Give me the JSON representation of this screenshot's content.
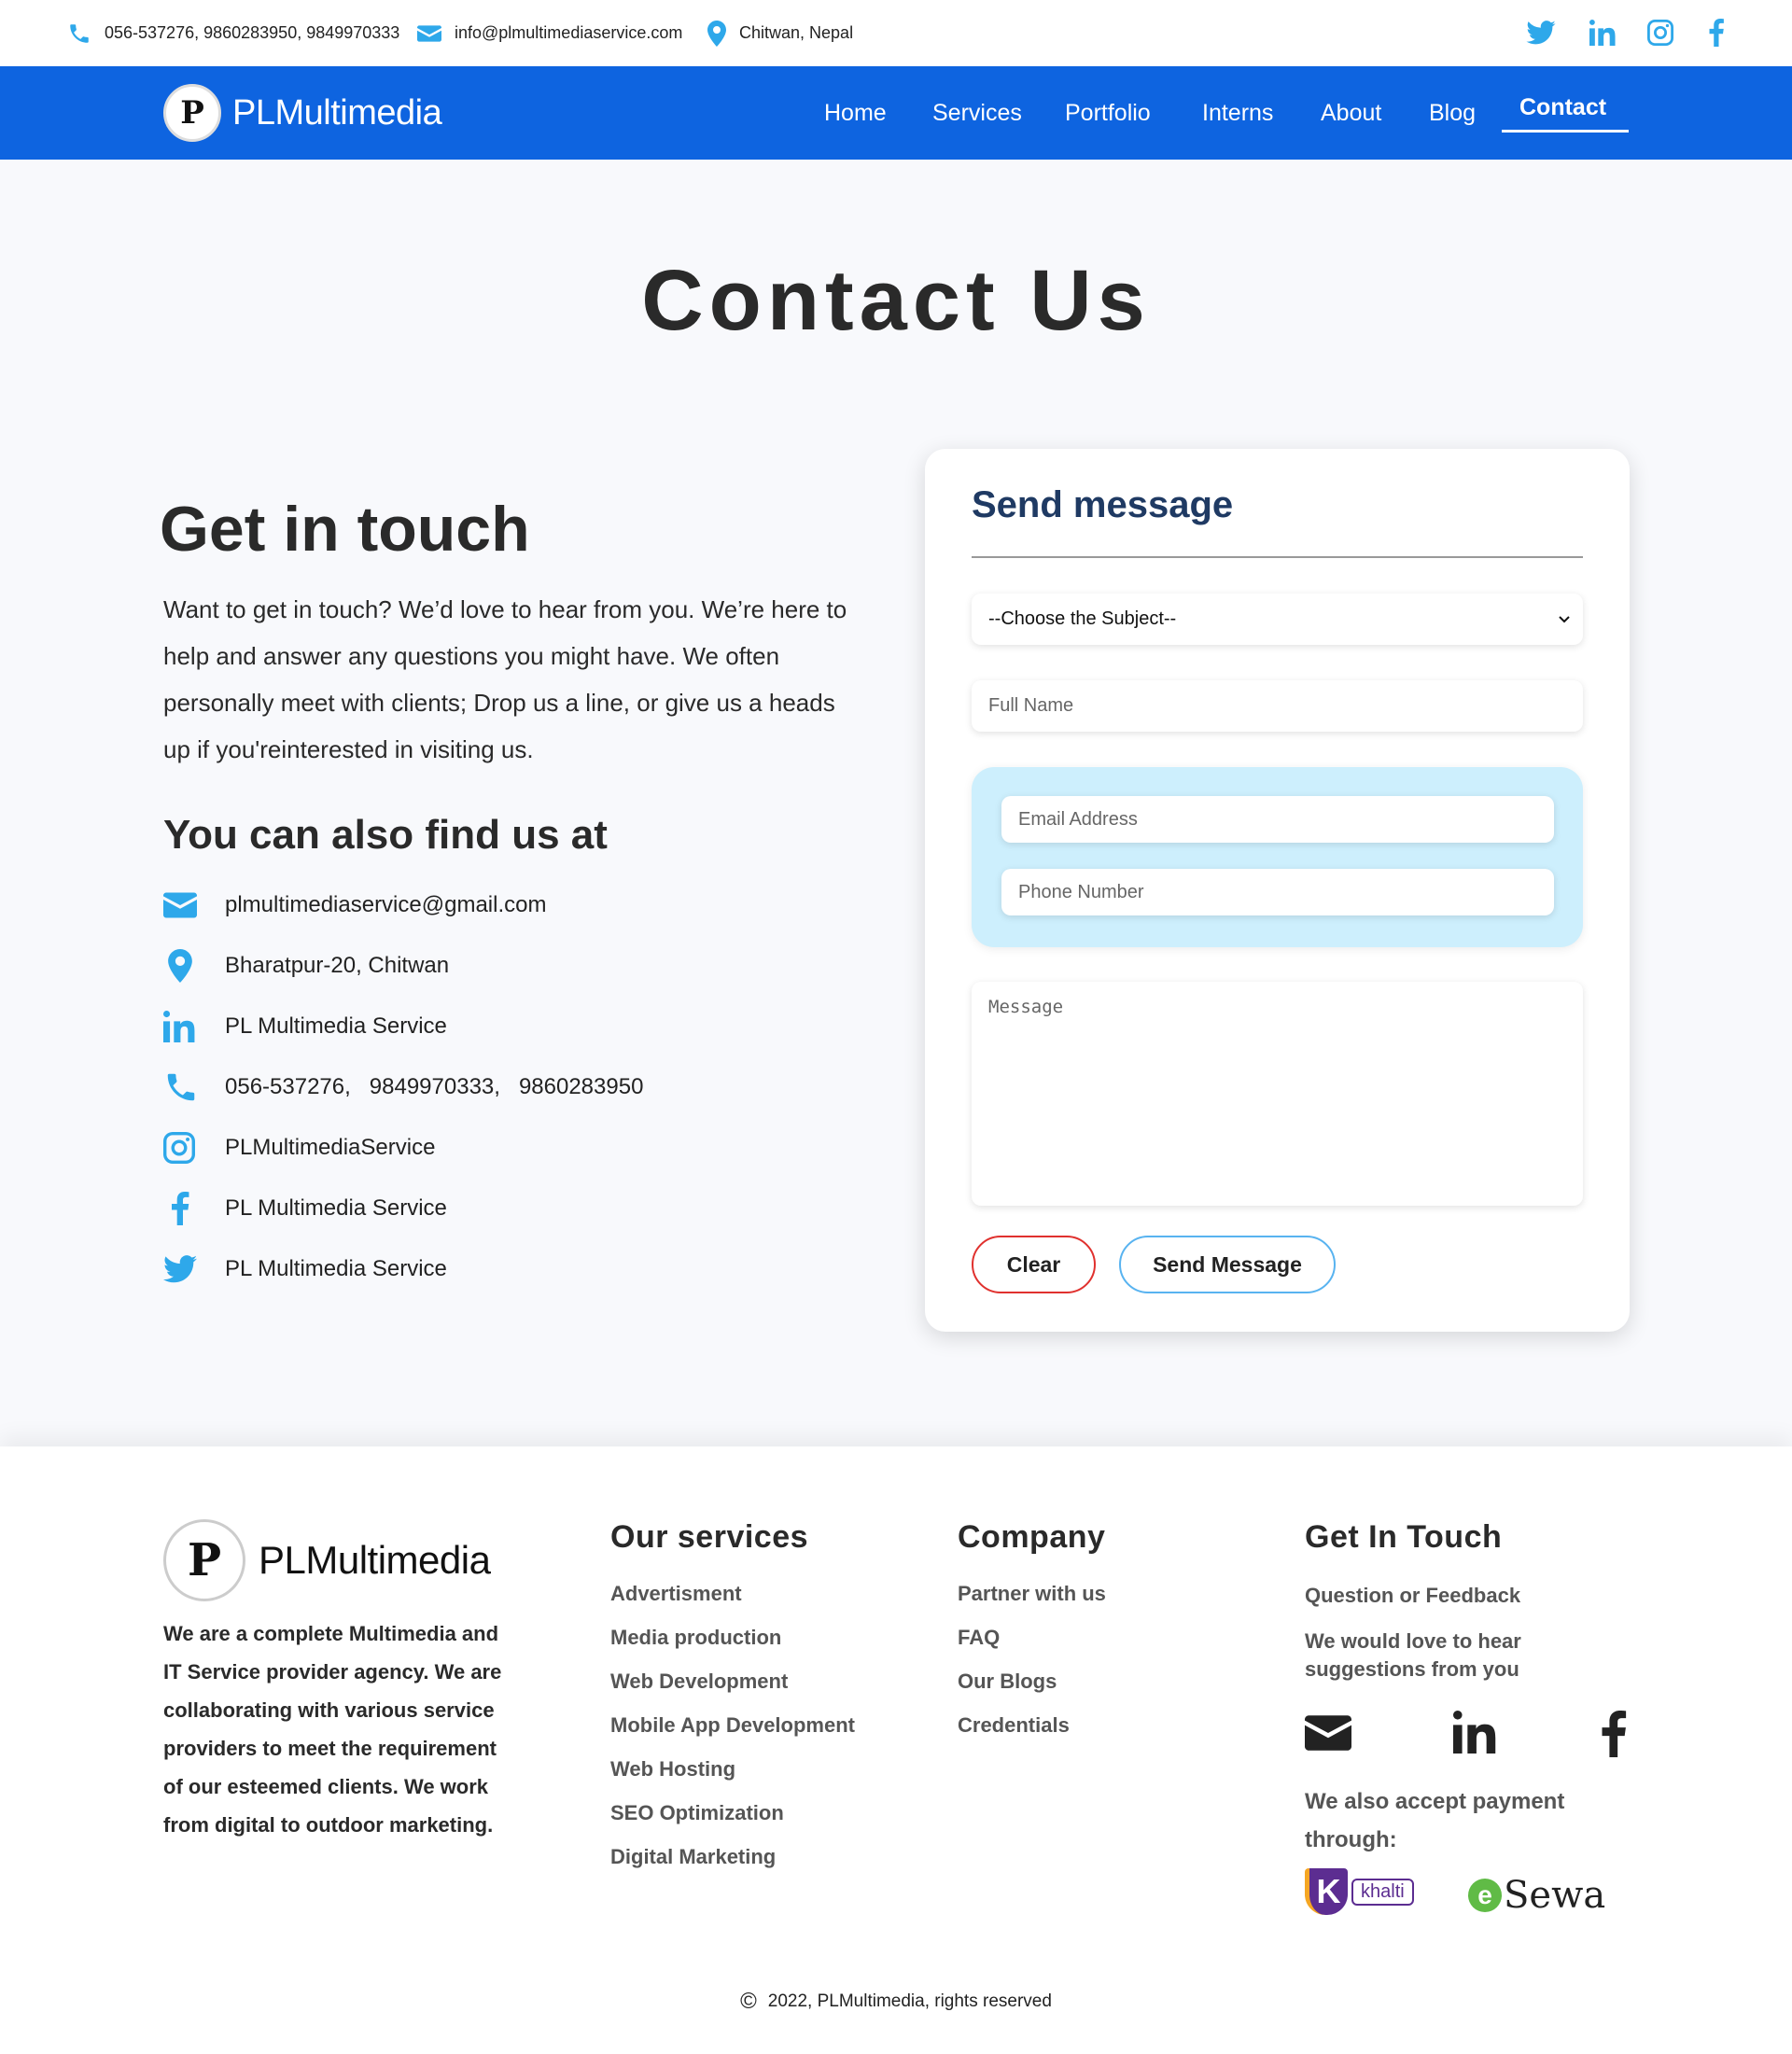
{
  "topbar": {
    "phones": "056-537276, 9860283950, 9849970333",
    "email": "info@plmultimediaservice.com",
    "location": "Chitwan, Nepal",
    "social": [
      "twitter-icon",
      "linkedin-icon",
      "instagram-icon",
      "facebook-icon"
    ]
  },
  "nav": {
    "brand": "PLMultimedia",
    "logo_letter": "P",
    "links": [
      "Home",
      "Services",
      "Portfolio",
      "Interns",
      "About",
      "Blog",
      "Contact"
    ],
    "active": "Contact"
  },
  "page_title": "Contact Us",
  "get_in_touch": {
    "title": "Get in touch",
    "body": "Want to get in touch? We’d love to hear from you. We’re here to help and answer any questions you might have. We often personally meet with clients; Drop us a line, or give us a heads up if you'reinterested in visiting us."
  },
  "find_us": {
    "title": "You can also find us at",
    "items": [
      {
        "icon": "envelope-icon",
        "text": "plmultimediaservice@gmail.com"
      },
      {
        "icon": "map-pin-icon",
        "text": "Bharatpur-20, Chitwan"
      },
      {
        "icon": "linkedin-icon",
        "text": "PL Multimedia Service"
      },
      {
        "icon": "phone-icon",
        "text": "056-537276,   9849970333,   9860283950"
      },
      {
        "icon": "instagram-icon",
        "text": "PLMultimediaService"
      },
      {
        "icon": "facebook-icon",
        "text": "PL Multimedia Service"
      },
      {
        "icon": "twitter-icon",
        "text": "PL Multimedia Service"
      }
    ]
  },
  "form": {
    "title": "Send message",
    "subject_value": "--Choose the Subject--",
    "name_placeholder": "Full Name",
    "email_placeholder": "Email Address",
    "phone_placeholder": "Phone Number",
    "message_placeholder": "Message",
    "clear_label": "Clear",
    "send_label": "Send Message"
  },
  "footer": {
    "brand": "PLMultimedia",
    "logo_letter": "P",
    "about": "We are a complete Multimedia and IT Service provider agency. We are collaborating with various service providers to meet the requirement of our esteemed clients. We work from digital to outdoor marketing.",
    "services_title": "Our services",
    "services": [
      "Advertisment",
      "Media production",
      "Web Development",
      "Mobile App Development",
      "Web Hosting",
      "SEO Optimization",
      "Digital Marketing"
    ],
    "company_title": "Company",
    "company": [
      "Partner with us",
      "FAQ",
      "Our Blogs",
      "Credentials"
    ],
    "touch_title": "Get In Touch",
    "question": "Question or Feedback",
    "suggestion": "We would love to hear suggestions from you",
    "social": [
      "envelope-icon",
      "linkedin-icon",
      "facebook-icon"
    ],
    "payment_text": "We also accept payment through:",
    "khalti_letter": "K",
    "khalti_label": "khalti",
    "esewa_letter": "e",
    "esewa_label": "Sewa",
    "copyright_symbol": "©",
    "copyright": "2022, PLMultimedia, rights reserved"
  },
  "colors": {
    "nav_blue": "#0e64e0",
    "icon_blue": "#2ea8ea",
    "card_title": "#1f3a63",
    "contact_box": "#cdeffd",
    "clear_border": "#e0312e",
    "send_border": "#58b3f0"
  }
}
